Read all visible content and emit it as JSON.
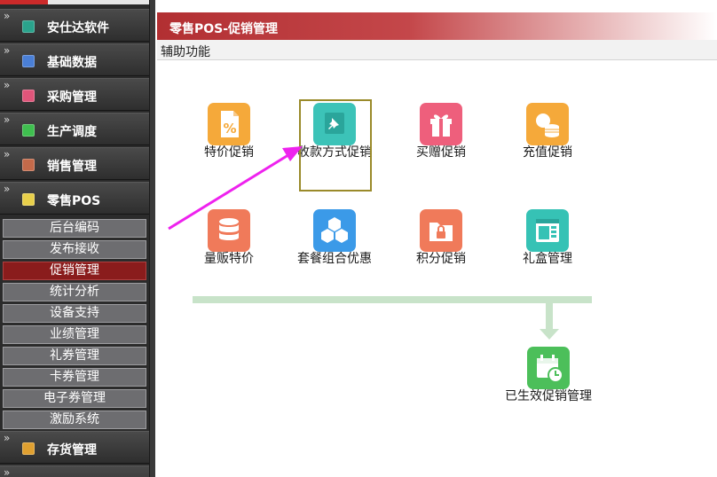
{
  "sidebar": {
    "menus": [
      {
        "label": "安仕达软件",
        "icon": "cube-teal-icon",
        "color": "#2aa38c"
      },
      {
        "label": "基础数据",
        "icon": "cube-blue-icon",
        "color": "#4a7fd6"
      },
      {
        "label": "采购管理",
        "icon": "cube-pink-icon",
        "color": "#e0557a"
      },
      {
        "label": "生产调度",
        "icon": "cube-green-icon",
        "color": "#3fbf4f"
      },
      {
        "label": "销售管理",
        "icon": "cube-brown-icon",
        "color": "#c46a4a"
      },
      {
        "label": "零售POS",
        "icon": "cube-yellow-icon",
        "color": "#e8cf4a"
      },
      {
        "label": "存货管理",
        "icon": "cube-amber-icon",
        "color": "#e0a030"
      }
    ],
    "submenu": [
      "后台编码",
      "发布接收",
      "促销管理",
      "统计分析",
      "设备支持",
      "业绩管理",
      "礼券管理",
      "卡券管理",
      "电子券管理",
      "激励系统"
    ],
    "active_submenu": "促销管理"
  },
  "title_bar": {
    "title": "零售POS-促销管理"
  },
  "toolbar": {
    "label": "辅助功能"
  },
  "tiles": [
    {
      "label": "特价促销",
      "icon": "percent-doc-icon",
      "color": "#f5a93a"
    },
    {
      "label": "收款方式促销",
      "icon": "pushpin-icon",
      "color": "#3cc3b8"
    },
    {
      "label": "买赠促销",
      "icon": "gift-icon",
      "color": "#ee5f7c"
    },
    {
      "label": "充值促销",
      "icon": "coins-icon",
      "color": "#f5a93a"
    },
    {
      "label": "量贩特价",
      "icon": "database-icon",
      "color": "#f07a5a"
    },
    {
      "label": "套餐组合优惠",
      "icon": "cubes-icon",
      "color": "#3b9ae8"
    },
    {
      "label": "积分促销",
      "icon": "folder-lock-icon",
      "color": "#f07a5a"
    },
    {
      "label": "礼盒管理",
      "icon": "window-icon",
      "color": "#36c2b5"
    }
  ],
  "bottom_tile": {
    "label": "已生效促销管理",
    "icon": "calendar-clock-icon",
    "color": "#4cbf5a"
  },
  "colors": {
    "title_bar": "#b22f32",
    "active_submenu": "#8a1c1c",
    "arrow": "#ee22ee",
    "flow": "#c8e3c9"
  }
}
